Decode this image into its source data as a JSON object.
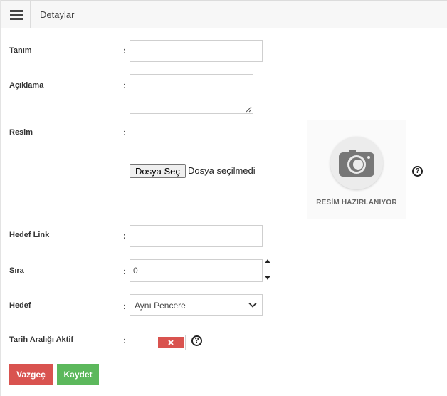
{
  "header": {
    "title": "Detaylar",
    "menu_icon": "hamburger-menu-icon"
  },
  "form": {
    "separator": ":",
    "tanim": {
      "label": "Tanım",
      "value": ""
    },
    "aciklama": {
      "label": "Açıklama",
      "value": ""
    },
    "resim": {
      "label": "Resim",
      "file_button": "Dosya Seç",
      "file_status": "Dosya seçilmedi",
      "placeholder_text": "RESİM HAZIRLANIYOR",
      "placeholder_icon": "camera-icon",
      "help": "?"
    },
    "hedef_link": {
      "label": "Hedef Link",
      "value": ""
    },
    "sira": {
      "label": "Sıra",
      "value": "0"
    },
    "hedef": {
      "label": "Hedef",
      "selected": "Aynı Pencere"
    },
    "tarih_araligi": {
      "label": "Tarih Aralığı Aktif",
      "state": "off",
      "help": "?"
    }
  },
  "actions": {
    "cancel": "Vazgeç",
    "save": "Kaydet"
  },
  "colors": {
    "danger": "#d9534f",
    "success": "#5cb85c",
    "header_bg": "#f7f7f7"
  }
}
